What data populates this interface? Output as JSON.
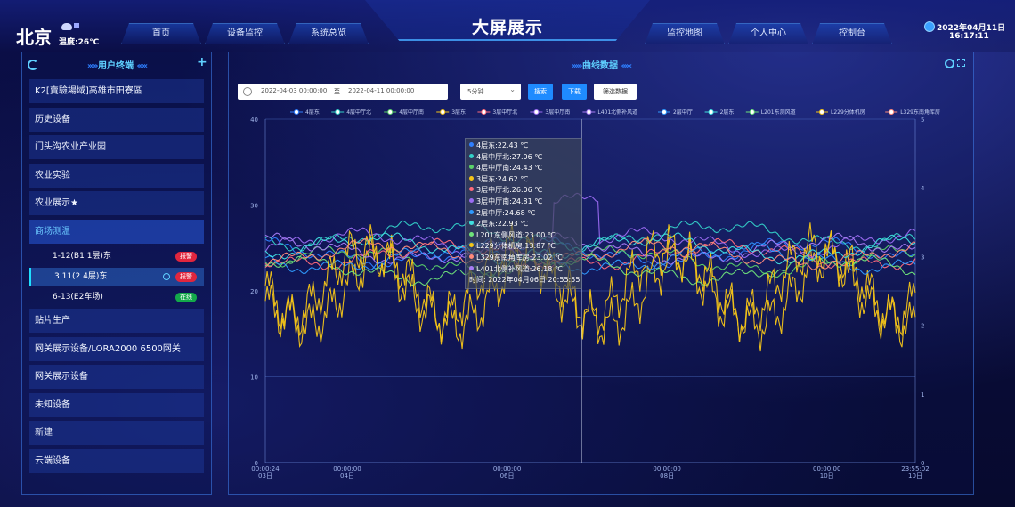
{
  "header": {
    "city": "北京",
    "temperature": "温度:26°C",
    "title": "大屏展示",
    "date": "2022年04月11日",
    "time": "16:17:11",
    "nav_left": [
      "首页",
      "设备监控",
      "系统总览"
    ],
    "nav_right": [
      "监控地图",
      "个人中心",
      "控制台"
    ]
  },
  "sidebar": {
    "title": "用户终端",
    "items": [
      {
        "label": "K2[賣驗場域]高雄市田寮區"
      },
      {
        "label": "历史设备"
      },
      {
        "label": "门头沟农业产业园"
      },
      {
        "label": "农业实验"
      },
      {
        "label": "农业展示★"
      },
      {
        "label": "商场测温"
      }
    ],
    "subitems": [
      {
        "label": "1-12(B1 1层)东",
        "badge": "报警",
        "badge_color": "#e0263e"
      },
      {
        "label": "3 11(2 4层)东",
        "badge": "报警",
        "badge_color": "#e0263e"
      },
      {
        "label": "6-13(E2车场)",
        "badge": "在线",
        "badge_color": "#13a84a"
      }
    ],
    "items_after": [
      {
        "label": "贴片生产"
      },
      {
        "label": "网关展示设备/LORA2000 6500网关"
      },
      {
        "label": "网关展示设备"
      },
      {
        "label": "未知设备"
      },
      {
        "label": "新建"
      },
      {
        "label": "云端设备"
      }
    ]
  },
  "main": {
    "title": "曲线数据",
    "date_from": "2022-04-03 00:00:00",
    "date_to_label": "至",
    "date_to": "2022-04-11 00:00:00",
    "interval": "5分钟",
    "search_btn": "搜索",
    "download_btn": "下载",
    "filter_btn": "筛选数据"
  },
  "tooltip": {
    "rows": [
      {
        "text": "4层东:22.43 ℃",
        "color": "#2f7fff"
      },
      {
        "text": "4层中厅北:27.06 ℃",
        "color": "#34d1c8"
      },
      {
        "text": "4层中厅南:24.43 ℃",
        "color": "#5bd36a"
      },
      {
        "text": "3层东:24.62 ℃",
        "color": "#f5c518"
      },
      {
        "text": "3层中厅北:26.06 ℃",
        "color": "#ff6b7a"
      },
      {
        "text": "3层中厅南:24.81 ℃",
        "color": "#9b6cf2"
      },
      {
        "text": "2层中厅:24.68 ℃",
        "color": "#2f9bff"
      },
      {
        "text": "2层东:22.93 ℃",
        "color": "#40e0e0"
      },
      {
        "text": "L201东侧风道:23.00 ℃",
        "color": "#6fe37a"
      },
      {
        "text": "L229分体机房:13.87 ℃",
        "color": "#f5c518"
      },
      {
        "text": "L329东南角库房:23.02 ℃",
        "color": "#ff8a7a"
      },
      {
        "text": "L401北侧补风道:26.18 ℃",
        "color": "#a77cf5"
      }
    ],
    "time": "时间:  2022年04月06日 20:55:55"
  },
  "chart_data": {
    "type": "line",
    "legend": [
      "4层东",
      "4层中厅北",
      "4层中厅南",
      "3层东",
      "3层中厅北",
      "3层中厅南",
      "L401北侧补风道",
      "2层中厅",
      "2层东",
      "L201东测风道",
      "L229分体机房",
      "L329东南角库房"
    ],
    "legend_colors": [
      "#2f7fff",
      "#34d1c8",
      "#5bd36a",
      "#f5c518",
      "#ff6b7a",
      "#9b6cf2",
      "#a77cf5",
      "#2f9bff",
      "#40e0e0",
      "#6fe37a",
      "#f5c518",
      "#ff8a7a"
    ],
    "y_left_ticks": [
      "40",
      "30",
      "20",
      "10",
      "0"
    ],
    "y_right_ticks": [
      "5",
      "4",
      "3",
      "2",
      "1",
      "0"
    ],
    "x_ticks": [
      {
        "top": "00:00:24",
        "bottom": "03日"
      },
      {
        "top": "00:00:00",
        "bottom": "04日"
      },
      {
        "top": "00:00:00",
        "bottom": "06日"
      },
      {
        "top": "00:00:00",
        "bottom": "08日"
      },
      {
        "top": "00:00:00",
        "bottom": "10日"
      },
      {
        "top": "23:55:02",
        "bottom": "10日"
      }
    ],
    "ylim": [
      0,
      40
    ],
    "y2lim": [
      0,
      5
    ],
    "series_baseline": [
      24.5,
      26.5,
      23.5,
      20,
      24.2,
      25.5,
      24.8,
      23.8,
      25,
      22.5,
      21,
      24.3
    ]
  }
}
